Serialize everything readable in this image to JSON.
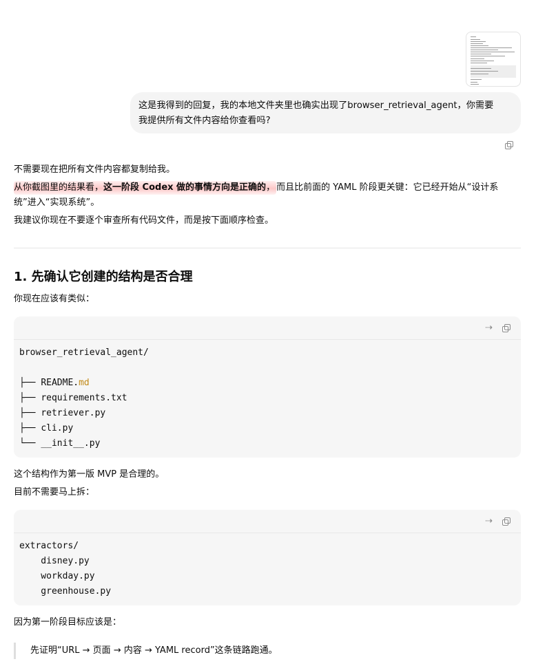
{
  "user_message": {
    "thumbnail_icon": "screenshot-thumbnail",
    "line1": "这是我得到的回复，我的本地文件夹里也确实出现了browser_retrieval_agent，你需要",
    "line2": "我提供所有文件内容给你查看吗?"
  },
  "assistant": {
    "p1": "不需要现在把所有文件内容都复制给我。",
    "p2_highlight_start": "从你截图里的结果看，",
    "p2_highlight_bold": "这一阶段 Codex 做的事情方向是正确的",
    "p2_highlight_end": "，",
    "p2_rest": "而且比前面的 YAML 阶段更关键：它已经开始从“设计系",
    "p2_line2": "统”进入“实现系统”。",
    "p3": "我建议你现在不要逐个审查所有代码文件，而是按下面顺序检查。",
    "section1_title": "1. 先确认它创建的结构是否合理",
    "section1_intro": "你现在应该有类似：",
    "code1": {
      "line1": "browser_retrieval_agent/",
      "tree": [
        {
          "prefix": "├── ",
          "name": "README.",
          "ext": "md"
        },
        {
          "prefix": "├── ",
          "name": "requirements.txt",
          "ext": ""
        },
        {
          "prefix": "├── ",
          "name": "retriever.py",
          "ext": ""
        },
        {
          "prefix": "├── ",
          "name": "cli.py",
          "ext": ""
        },
        {
          "prefix": "└── ",
          "name": "__init__.py",
          "ext": ""
        }
      ]
    },
    "p4": "这个结构作为第一版 MVP 是合理的。",
    "p5": "目前不需要马上拆：",
    "code2": {
      "lines": [
        "extractors/",
        "    disney.py",
        "    workday.py",
        "    greenhouse.py"
      ]
    },
    "p6": "因为第一阶段目标应该是：",
    "quote": "先证明“URL → 页面 → 内容 → YAML record”这条链路跑通。"
  },
  "icons": {
    "copy": "copy-icon",
    "wrap": "wrap-icon",
    "wrap_glyph": "⇢"
  },
  "colors": {
    "highlight": "#f7a3a3",
    "file_ext": "#c28a18",
    "bubble_bg": "#f4f4f4",
    "code_bg": "#f6f6f6"
  }
}
